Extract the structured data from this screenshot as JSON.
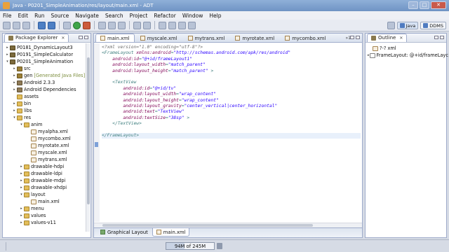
{
  "window": {
    "title": "Java - P0201_SimpleAnimation/res/layout/main.xml - ADT",
    "btn_min": "–",
    "btn_max": "□",
    "btn_close": "✕"
  },
  "menu": [
    "File",
    "Edit",
    "Run",
    "Source",
    "Navigate",
    "Search",
    "Project",
    "Refactor",
    "Window",
    "Help"
  ],
  "perspectives": {
    "java": "Java",
    "ddms": "DDMS"
  },
  "package_explorer": {
    "title": "Package Explorer",
    "items": [
      {
        "label": "P0181_DynamicLayout3",
        "depth": 0,
        "twisty": "▸",
        "icon": "proj"
      },
      {
        "label": "P0191_SimpleCalculator",
        "depth": 0,
        "twisty": "▸",
        "icon": "proj"
      },
      {
        "label": "P0201_SimpleAnimation",
        "depth": 0,
        "twisty": "▾",
        "icon": "proj"
      },
      {
        "label": "src",
        "depth": 1,
        "twisty": "▸",
        "icon": "pkg"
      },
      {
        "label": "gen",
        "note": "[Generated Java Files]",
        "depth": 1,
        "twisty": "▸",
        "icon": "pkg"
      },
      {
        "label": "Android 2.3.3",
        "depth": 1,
        "twisty": "▸",
        "icon": "lib"
      },
      {
        "label": "Android Dependencies",
        "depth": 1,
        "twisty": "▸",
        "icon": "lib"
      },
      {
        "label": "assets",
        "depth": 1,
        "twisty": "",
        "icon": "folder"
      },
      {
        "label": "bin",
        "depth": 1,
        "twisty": "▸",
        "icon": "folder"
      },
      {
        "label": "libs",
        "depth": 1,
        "twisty": "▸",
        "icon": "folder"
      },
      {
        "label": "res",
        "depth": 1,
        "twisty": "▾",
        "icon": "folder"
      },
      {
        "label": "anim",
        "depth": 2,
        "twisty": "▾",
        "icon": "folder"
      },
      {
        "label": "myalpha.xml",
        "depth": 3,
        "twisty": "",
        "icon": "xml"
      },
      {
        "label": "mycombo.xml",
        "depth": 3,
        "twisty": "",
        "icon": "xml"
      },
      {
        "label": "myrotate.xml",
        "depth": 3,
        "twisty": "",
        "icon": "xml"
      },
      {
        "label": "myscale.xml",
        "depth": 3,
        "twisty": "",
        "icon": "xml"
      },
      {
        "label": "mytrans.xml",
        "depth": 3,
        "twisty": "",
        "icon": "xml"
      },
      {
        "label": "drawable-hdpi",
        "depth": 2,
        "twisty": "▸",
        "icon": "folder"
      },
      {
        "label": "drawable-ldpi",
        "depth": 2,
        "twisty": "▸",
        "icon": "folder"
      },
      {
        "label": "drawable-mdpi",
        "depth": 2,
        "twisty": "▸",
        "icon": "folder"
      },
      {
        "label": "drawable-xhdpi",
        "depth": 2,
        "twisty": "▸",
        "icon": "folder"
      },
      {
        "label": "layout",
        "depth": 2,
        "twisty": "▾",
        "icon": "folder"
      },
      {
        "label": "main.xml",
        "depth": 3,
        "twisty": "",
        "icon": "xml"
      },
      {
        "label": "menu",
        "depth": 2,
        "twisty": "▸",
        "icon": "folder"
      },
      {
        "label": "values",
        "depth": 2,
        "twisty": "▸",
        "icon": "folder"
      },
      {
        "label": "values-v11",
        "depth": 2,
        "twisty": "▸",
        "icon": "folder"
      }
    ]
  },
  "editor": {
    "tabs": [
      {
        "label": "main.xml",
        "active": true
      },
      {
        "label": "myscale.xml",
        "active": false
      },
      {
        "label": "mytrans.xml",
        "active": false
      },
      {
        "label": "myrotate.xml",
        "active": false
      },
      {
        "label": "mycombo.xml",
        "active": false
      }
    ],
    "overflow": "»1",
    "lines": [
      [
        [
          "decl",
          "<?xml version=\"1.0\" encoding=\"utf-8\"?>"
        ]
      ],
      [
        [
          "tag",
          "<FrameLayout "
        ],
        [
          "attr",
          "xmlns:android"
        ],
        [
          "tag",
          "="
        ],
        [
          "val",
          "\"http://schemas.android.com/apk/res/android\""
        ]
      ],
      [
        [
          "pad",
          "    "
        ],
        [
          "attr",
          "android:id"
        ],
        [
          "tag",
          "="
        ],
        [
          "val",
          "\"@+id/frameLayout1\""
        ]
      ],
      [
        [
          "pad",
          "    "
        ],
        [
          "attr",
          "android:layout_width"
        ],
        [
          "tag",
          "="
        ],
        [
          "val",
          "\"match_parent\""
        ]
      ],
      [
        [
          "pad",
          "    "
        ],
        [
          "attr",
          "android:layout_height"
        ],
        [
          "tag",
          "="
        ],
        [
          "val",
          "\"match_parent\""
        ],
        [
          "tag",
          " >"
        ]
      ],
      [
        [
          "pad",
          ""
        ]
      ],
      [
        [
          "pad",
          "    "
        ],
        [
          "tag",
          "<TextView"
        ]
      ],
      [
        [
          "pad",
          "        "
        ],
        [
          "attr",
          "android:id"
        ],
        [
          "tag",
          "="
        ],
        [
          "val",
          "\"@+id/tv\""
        ]
      ],
      [
        [
          "pad",
          "        "
        ],
        [
          "attr",
          "android:layout_width"
        ],
        [
          "tag",
          "="
        ],
        [
          "val",
          "\"wrap_content\""
        ]
      ],
      [
        [
          "pad",
          "        "
        ],
        [
          "attr",
          "android:layout_height"
        ],
        [
          "tag",
          "="
        ],
        [
          "val",
          "\"wrap_content\""
        ]
      ],
      [
        [
          "pad",
          "        "
        ],
        [
          "attr",
          "android:layout_gravity"
        ],
        [
          "tag",
          "="
        ],
        [
          "val",
          "\"center_vertical|center_horizontal\""
        ]
      ],
      [
        [
          "pad",
          "        "
        ],
        [
          "attr",
          "android:text"
        ],
        [
          "tag",
          "="
        ],
        [
          "val",
          "\"TextView\""
        ]
      ],
      [
        [
          "pad",
          "        "
        ],
        [
          "attr",
          "android:textSize"
        ],
        [
          "tag",
          "="
        ],
        [
          "val",
          "\"38sp\""
        ],
        [
          "tag",
          " >"
        ]
      ],
      [
        [
          "pad",
          "    "
        ],
        [
          "tag",
          "</TextView>"
        ]
      ],
      [
        [
          "pad",
          ""
        ]
      ],
      [
        [
          "tag",
          "</FrameLayout>"
        ]
      ]
    ],
    "current_line": 15,
    "bottom_tabs": [
      {
        "label": "Graphical Layout",
        "active": false
      },
      {
        "label": "main.xml",
        "active": true
      }
    ]
  },
  "outline": {
    "title": "Outline",
    "items": [
      {
        "label": "?-? xml",
        "depth": 0
      },
      {
        "label": "FrameLayout: @+id/frameLayc",
        "depth": 0
      }
    ]
  },
  "status": {
    "heap_text": "94M of 245M",
    "heap_used_fraction": 0.384
  },
  "colors": {
    "tag": "#3f7f7f",
    "attr": "#7f0055",
    "val": "#2a00ff",
    "decl": "#6a6a6a"
  }
}
